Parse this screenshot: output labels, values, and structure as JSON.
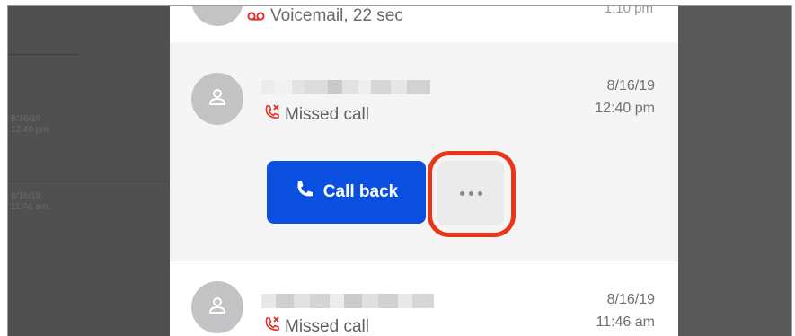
{
  "background_left": {
    "entries": [
      {
        "date": "8/16/19",
        "time": "12:40 pm"
      },
      {
        "date": "8/16/19",
        "time": "11:46 am"
      }
    ]
  },
  "calls": [
    {
      "status": "Voicemail, 22 sec",
      "time": "1:10 pm",
      "type": "voicemail"
    },
    {
      "status": "Missed call",
      "date": "8/16/19",
      "time": "12:40 pm",
      "type": "missed",
      "expanded": true,
      "actions": {
        "call_back_label": "Call back",
        "more_icon": "more-horizontal-icon"
      }
    },
    {
      "status": "Missed call",
      "date": "8/16/19",
      "time": "11:46 am",
      "type": "missed"
    }
  ],
  "colors": {
    "primary_button": "#0b4fe0",
    "missed_icon": "#e0332a",
    "highlight_ring": "#e8361d",
    "avatar": "#c3c3c6"
  }
}
